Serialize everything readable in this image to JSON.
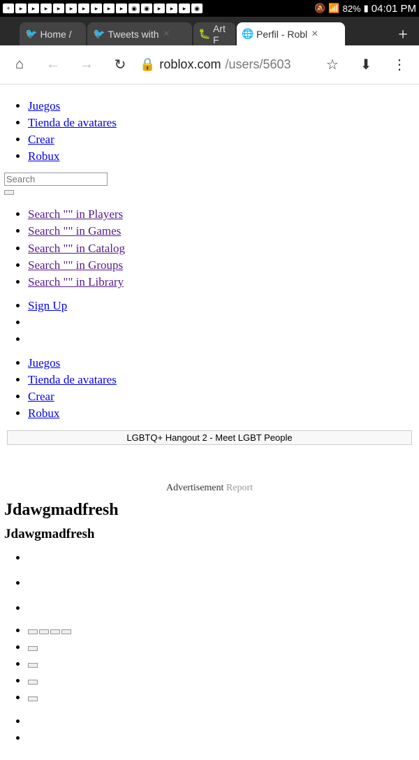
{
  "status": {
    "battery": "82%",
    "time": "04:01 PM"
  },
  "tabs": {
    "t0": "Home /",
    "t1": "Tweets with",
    "t2": "Art F",
    "t3": "Perfil - Robl"
  },
  "url": {
    "domain": "roblox.com",
    "path": "/users/5603"
  },
  "nav1": {
    "juegos": "Juegos",
    "tienda": "Tienda de avatares",
    "crear": "Crear",
    "robux": "Robux"
  },
  "search": {
    "placeholder": "Search",
    "players": "Search \"\" in Players",
    "games": "Search \"\" in Games",
    "catalog": "Search \"\" in Catalog",
    "groups": "Search \"\" in Groups",
    "library": "Search \"\" in Library"
  },
  "signup": "Sign Up",
  "nav2": {
    "juegos": "Juegos",
    "tienda": "Tienda de avatares",
    "crear": "Crear",
    "robux": "Robux"
  },
  "ad": {
    "alt": "LGBTQ+ Hangout 2 - Meet LGBT People",
    "label": "Advertisement",
    "report": "Report"
  },
  "profile": {
    "h1": "Jdawgmadfresh",
    "h2": "Jdawgmadfresh"
  }
}
